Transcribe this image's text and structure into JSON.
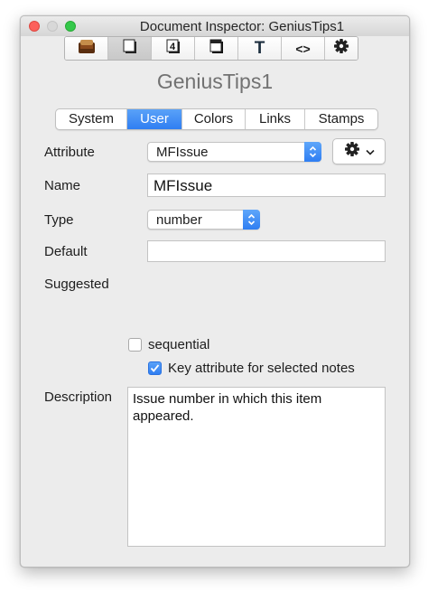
{
  "window": {
    "title": "Document Inspector: GeniusTips1"
  },
  "toolbar": {
    "buttons": [
      {
        "name": "document-icon",
        "selected": false
      },
      {
        "name": "page-icon",
        "selected": true
      },
      {
        "name": "four-icon",
        "selected": false,
        "glyph": "4"
      },
      {
        "name": "shadow-page-icon",
        "selected": false
      },
      {
        "name": "text-icon",
        "selected": false,
        "glyph": "T"
      },
      {
        "name": "code-icon",
        "selected": false,
        "glyph": "<>"
      },
      {
        "name": "gear-icon",
        "selected": false
      }
    ]
  },
  "document_name": "GeniusTips1",
  "tabs": [
    "System",
    "User",
    "Colors",
    "Links",
    "Stamps"
  ],
  "selected_tab": "User",
  "form": {
    "attribute": {
      "label": "Attribute",
      "value": "MFIssue"
    },
    "name": {
      "label": "Name",
      "value": "MFIssue"
    },
    "type": {
      "label": "Type",
      "value": "number"
    },
    "default": {
      "label": "Default",
      "value": ""
    },
    "suggested": {
      "label": "Suggested"
    },
    "sequential": {
      "label": "sequential",
      "checked": false
    },
    "key_attribute": {
      "label": "Key attribute for selected notes",
      "checked": true
    },
    "description": {
      "label": "Description",
      "value": "Issue number in which this item appeared."
    }
  },
  "colors": {
    "accent": "#2f7ef2"
  }
}
